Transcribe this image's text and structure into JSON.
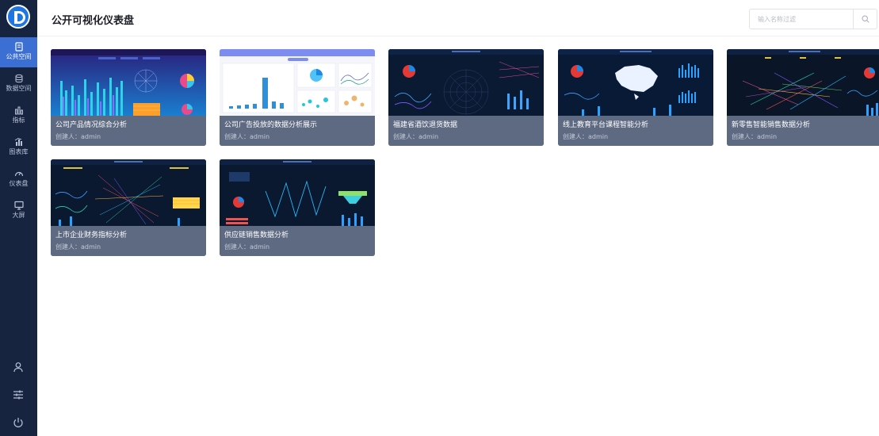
{
  "header": {
    "title": "公开可视化仪表盘",
    "search_placeholder": "输入名称过滤"
  },
  "sidebar": {
    "items": [
      {
        "label": "公共空间",
        "icon": "document-icon",
        "active": true
      },
      {
        "label": "数据空间",
        "icon": "database-icon",
        "active": false
      },
      {
        "label": "指标",
        "icon": "metrics-icon",
        "active": false
      },
      {
        "label": "图表库",
        "icon": "chart-library-icon",
        "active": false
      },
      {
        "label": "仪表盘",
        "icon": "dashboard-gauge-icon",
        "active": false
      },
      {
        "label": "大屏",
        "icon": "monitor-icon",
        "active": false
      }
    ],
    "bottom": [
      "user-icon",
      "settings-sliders-icon",
      "power-icon"
    ]
  },
  "colors": {
    "sidebar_bg": "#16243f",
    "active_nav": "#3b6fd4",
    "card_footer": "#5e6a82"
  },
  "cards": [
    {
      "title": "公司产品情况综合分析",
      "creator": "创建人：admin"
    },
    {
      "title": "公司广告投放的数据分析展示",
      "creator": "创建人：admin"
    },
    {
      "title": "福建省酒饮退货数据",
      "creator": "创建人：admin"
    },
    {
      "title": "线上教育平台课程智能分析",
      "creator": "创建人：admin"
    },
    {
      "title": "新零售智能销售数据分析",
      "creator": "创建人：admin"
    },
    {
      "title": "上市企业财务指标分析",
      "creator": "创建人：admin"
    },
    {
      "title": "供应链销售数据分析",
      "creator": "创建人：admin"
    }
  ]
}
